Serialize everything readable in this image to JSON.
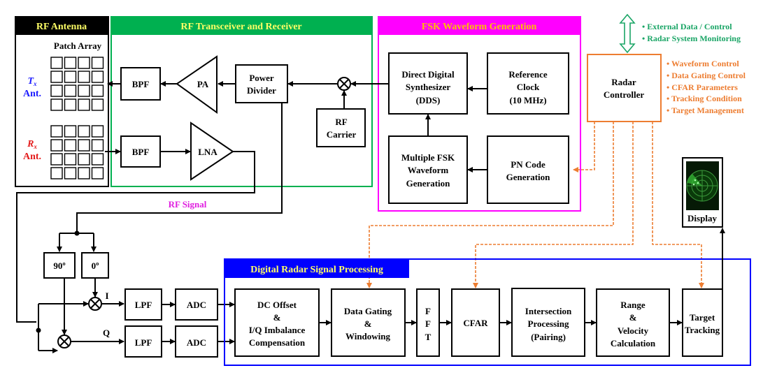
{
  "colors": {
    "antenna_header": "#000000",
    "transceiver": "#00b050",
    "fsk": "#ff00ff",
    "dsp": "#0000ff",
    "controller": "#ed7d31",
    "header_text": "#ffff66",
    "fsk_header_text": "#ffc000",
    "external": "#1aa566",
    "tx": "#1a1aff",
    "rx": "#e31a1a"
  },
  "antenna": {
    "title": "RF Antenna",
    "patch_label": "Patch Array",
    "tx_label": [
      "T",
      "x",
      "Ant."
    ],
    "rx_label": [
      "R",
      "x",
      "Ant."
    ]
  },
  "transceiver": {
    "title": "RF Transceiver and Receiver",
    "bpf_tx": "BPF",
    "pa": "PA",
    "power_divider": [
      "Power",
      "Divider"
    ],
    "rf_carrier": [
      "RF",
      "Carrier"
    ],
    "bpf_rx": "BPF",
    "lna": "LNA"
  },
  "fsk": {
    "title": "FSK Waveform Generation",
    "dds": [
      "Direct Digital",
      "Synthesizer",
      "(DDS)"
    ],
    "ref_clock": [
      "Reference",
      "Clock",
      "(10 MHz)"
    ],
    "multi_fsk": [
      "Multiple FSK",
      "Waveform",
      "Generation"
    ],
    "pn_code": [
      "PN Code",
      "Generation"
    ]
  },
  "controller": {
    "label": [
      "Radar",
      "Controller"
    ],
    "external": [
      "External Data / Control",
      "Radar System Monitoring"
    ],
    "functions": [
      "Waveform Control",
      "Data Gating Control",
      "CFAR Parameters",
      "Tracking Condition",
      "Target Management"
    ]
  },
  "rf_signal": "RF Signal",
  "iq": {
    "phase90": "90º",
    "phase0": "0º",
    "i": "I",
    "q": "Q",
    "lpf": "LPF",
    "adc": "ADC"
  },
  "dsp": {
    "title": "Digital Radar Signal Processing",
    "dc_offset": [
      "DC Offset",
      "&",
      "I/Q Imbalance",
      "Compensation"
    ],
    "data_gating": [
      "Data Gating",
      "&",
      "Windowing"
    ],
    "fft": [
      "F",
      "F",
      "T"
    ],
    "cfar": "CFAR",
    "intersection": [
      "Intersection",
      "Processing",
      "(Pairing)"
    ],
    "range_velocity": [
      "Range",
      "&",
      "Velocity",
      "Calculation"
    ],
    "target_tracking": [
      "Target",
      "Tracking"
    ]
  },
  "display": {
    "label": "Display",
    "icon": "radar-screen-icon"
  }
}
